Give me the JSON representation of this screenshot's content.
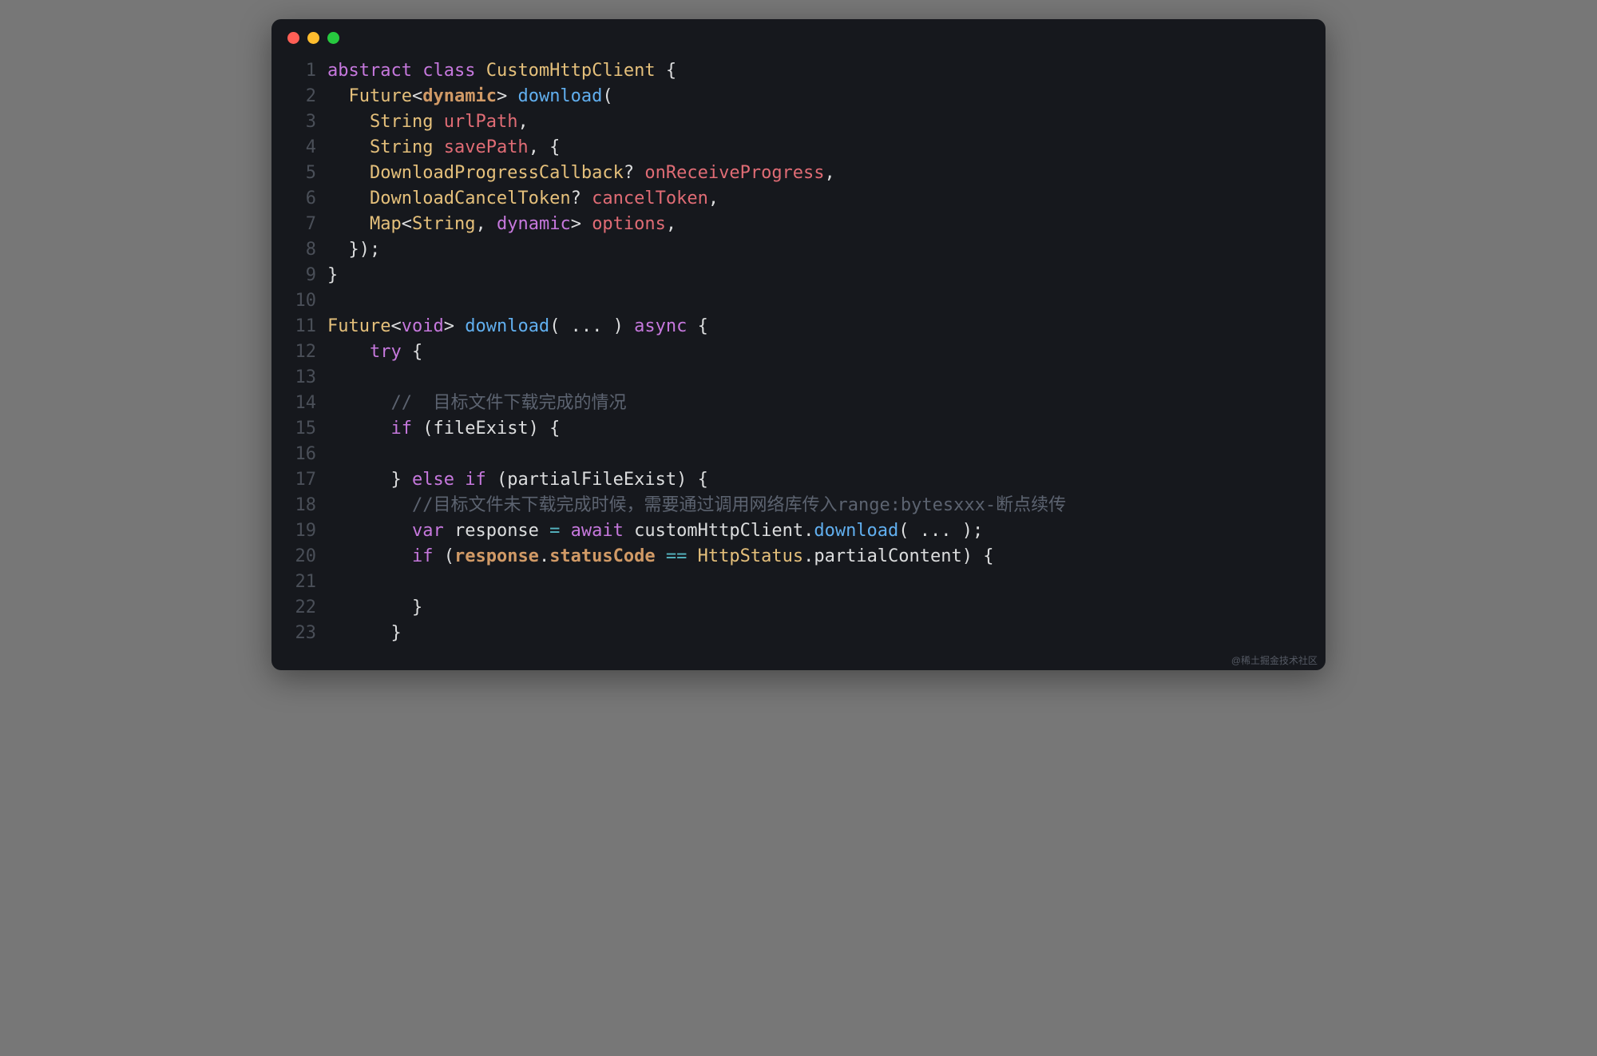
{
  "window": {
    "traffic": [
      "red",
      "yellow",
      "green"
    ]
  },
  "code": {
    "lines": [
      {
        "n": 1,
        "tokens": [
          {
            "t": "abstract",
            "c": "k-purple"
          },
          {
            "t": " "
          },
          {
            "t": "class",
            "c": "k-purple"
          },
          {
            "t": " "
          },
          {
            "t": "CustomHttpClient",
            "c": "k-yellow"
          },
          {
            "t": " {",
            "c": "k-white"
          }
        ]
      },
      {
        "n": 2,
        "tokens": [
          {
            "t": "  "
          },
          {
            "t": "Future",
            "c": "k-yellow"
          },
          {
            "t": "<",
            "c": "k-white"
          },
          {
            "t": "dynamic",
            "c": "k-orange k-bold"
          },
          {
            "t": ">",
            "c": "k-white"
          },
          {
            "t": " "
          },
          {
            "t": "download",
            "c": "k-blue"
          },
          {
            "t": "(",
            "c": "k-white"
          }
        ]
      },
      {
        "n": 3,
        "tokens": [
          {
            "t": "    "
          },
          {
            "t": "String",
            "c": "k-yellow"
          },
          {
            "t": " "
          },
          {
            "t": "urlPath",
            "c": "k-red"
          },
          {
            "t": ",",
            "c": "k-white"
          }
        ]
      },
      {
        "n": 4,
        "tokens": [
          {
            "t": "    "
          },
          {
            "t": "String",
            "c": "k-yellow"
          },
          {
            "t": " "
          },
          {
            "t": "savePath",
            "c": "k-red"
          },
          {
            "t": ", {",
            "c": "k-white"
          }
        ]
      },
      {
        "n": 5,
        "tokens": [
          {
            "t": "    "
          },
          {
            "t": "DownloadProgressCallback",
            "c": "k-yellow"
          },
          {
            "t": "?",
            "c": "k-white"
          },
          {
            "t": " "
          },
          {
            "t": "onReceiveProgress",
            "c": "k-red"
          },
          {
            "t": ",",
            "c": "k-white"
          }
        ]
      },
      {
        "n": 6,
        "tokens": [
          {
            "t": "    "
          },
          {
            "t": "DownloadCancelToken",
            "c": "k-yellow"
          },
          {
            "t": "?",
            "c": "k-white"
          },
          {
            "t": " "
          },
          {
            "t": "cancelToken",
            "c": "k-red"
          },
          {
            "t": ",",
            "c": "k-white"
          }
        ]
      },
      {
        "n": 7,
        "tokens": [
          {
            "t": "    "
          },
          {
            "t": "Map",
            "c": "k-yellow"
          },
          {
            "t": "<",
            "c": "k-white"
          },
          {
            "t": "String",
            "c": "k-yellow"
          },
          {
            "t": ", ",
            "c": "k-white"
          },
          {
            "t": "dynamic",
            "c": "k-purple"
          },
          {
            "t": ">",
            "c": "k-white"
          },
          {
            "t": " "
          },
          {
            "t": "options",
            "c": "k-red"
          },
          {
            "t": ",",
            "c": "k-white"
          }
        ]
      },
      {
        "n": 8,
        "tokens": [
          {
            "t": "  });",
            "c": "k-white"
          }
        ]
      },
      {
        "n": 9,
        "tokens": [
          {
            "t": "}",
            "c": "k-white"
          }
        ]
      },
      {
        "n": 10,
        "tokens": [
          {
            "t": ""
          }
        ]
      },
      {
        "n": 11,
        "tokens": [
          {
            "t": "Future",
            "c": "k-yellow"
          },
          {
            "t": "<",
            "c": "k-white"
          },
          {
            "t": "void",
            "c": "k-purple"
          },
          {
            "t": ">",
            "c": "k-white"
          },
          {
            "t": " "
          },
          {
            "t": "download",
            "c": "k-blue"
          },
          {
            "t": "( ... ) ",
            "c": "k-white"
          },
          {
            "t": "async",
            "c": "k-purple"
          },
          {
            "t": " {",
            "c": "k-white"
          }
        ]
      },
      {
        "n": 12,
        "tokens": [
          {
            "t": "    "
          },
          {
            "t": "try",
            "c": "k-purple"
          },
          {
            "t": " {",
            "c": "k-white"
          }
        ]
      },
      {
        "n": 13,
        "tokens": [
          {
            "t": ""
          }
        ]
      },
      {
        "n": 14,
        "tokens": [
          {
            "t": "      "
          },
          {
            "t": "//  目标文件下载完成的情况",
            "c": "k-gray"
          }
        ]
      },
      {
        "n": 15,
        "tokens": [
          {
            "t": "      "
          },
          {
            "t": "if",
            "c": "k-purple"
          },
          {
            "t": " (fileExist) {",
            "c": "k-white"
          }
        ]
      },
      {
        "n": 16,
        "tokens": [
          {
            "t": ""
          }
        ]
      },
      {
        "n": 17,
        "tokens": [
          {
            "t": "      } ",
            "c": "k-white"
          },
          {
            "t": "else",
            "c": "k-purple"
          },
          {
            "t": " ",
            "c": "k-white"
          },
          {
            "t": "if",
            "c": "k-purple"
          },
          {
            "t": " (partialFileExist) {",
            "c": "k-white"
          }
        ]
      },
      {
        "n": 18,
        "tokens": [
          {
            "t": "        "
          },
          {
            "t": "//目标文件未下载完成时候，需要通过调用网络库传入range:bytesxxx-断点续传",
            "c": "k-gray"
          }
        ]
      },
      {
        "n": 19,
        "tokens": [
          {
            "t": "        "
          },
          {
            "t": "var",
            "c": "k-purple"
          },
          {
            "t": " response ",
            "c": "k-white"
          },
          {
            "t": "=",
            "c": "k-teal"
          },
          {
            "t": " ",
            "c": "k-white"
          },
          {
            "t": "await",
            "c": "k-purple"
          },
          {
            "t": " customHttpClient.",
            "c": "k-white"
          },
          {
            "t": "download",
            "c": "k-blue"
          },
          {
            "t": "( ... );",
            "c": "k-white"
          }
        ]
      },
      {
        "n": 20,
        "tokens": [
          {
            "t": "        "
          },
          {
            "t": "if",
            "c": "k-purple"
          },
          {
            "t": " (",
            "c": "k-white"
          },
          {
            "t": "response",
            "c": "k-orange k-bold"
          },
          {
            "t": ".",
            "c": "k-white"
          },
          {
            "t": "statusCode",
            "c": "k-orange k-bold"
          },
          {
            "t": " ",
            "c": "k-white"
          },
          {
            "t": "==",
            "c": "k-teal"
          },
          {
            "t": " ",
            "c": "k-white"
          },
          {
            "t": "HttpStatus",
            "c": "k-yellow"
          },
          {
            "t": ".partialContent) {",
            "c": "k-white"
          }
        ]
      },
      {
        "n": 21,
        "tokens": [
          {
            "t": ""
          }
        ]
      },
      {
        "n": 22,
        "tokens": [
          {
            "t": "        }",
            "c": "k-white"
          }
        ]
      },
      {
        "n": 23,
        "tokens": [
          {
            "t": "      }",
            "c": "k-white"
          }
        ]
      }
    ]
  },
  "watermark": "@稀土掘金技术社区"
}
